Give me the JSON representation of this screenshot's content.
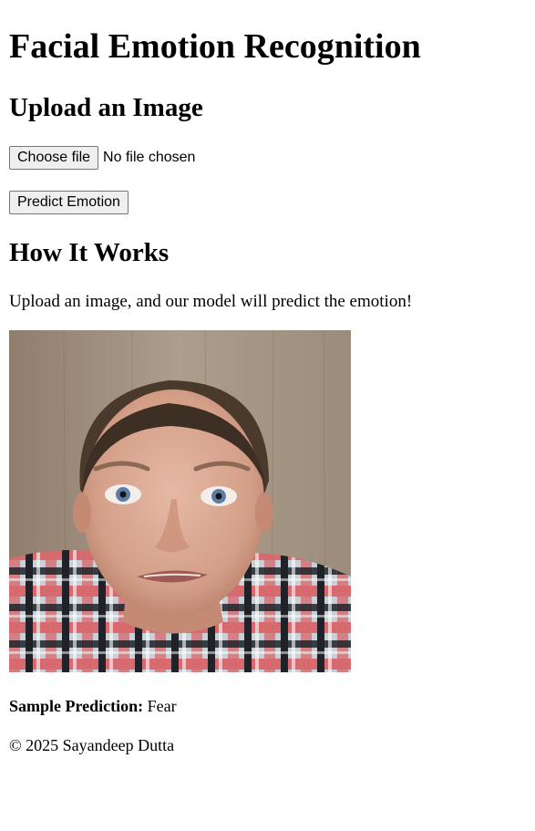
{
  "page_title": "Facial Emotion Recognition",
  "upload_section": {
    "heading": "Upload an Image",
    "choose_file_label": "Choose file",
    "file_status": "No file chosen",
    "predict_button_label": "Predict Emotion"
  },
  "how_section": {
    "heading": "How It Works",
    "description": "Upload an image, and our model will predict the emotion!",
    "sample_image_subject": "face-photo",
    "sample_prediction_label": "Sample Prediction:",
    "sample_prediction_value": "Fear"
  },
  "footer": {
    "text": "© 2025 Sayandeep Dutta"
  }
}
